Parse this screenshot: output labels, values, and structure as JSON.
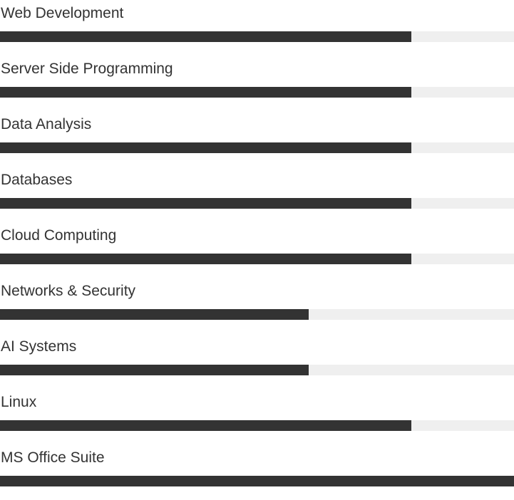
{
  "skills": [
    {
      "label": "Web Development",
      "level": 0.8
    },
    {
      "label": "Server Side Programming",
      "level": 0.8
    },
    {
      "label": "Data Analysis",
      "level": 0.8
    },
    {
      "label": "Databases",
      "level": 0.8
    },
    {
      "label": "Cloud Computing",
      "level": 0.8
    },
    {
      "label": "Networks & Security",
      "level": 0.6
    },
    {
      "label": "AI Systems",
      "level": 0.6
    },
    {
      "label": "Linux",
      "level": 0.8
    },
    {
      "label": "MS Office Suite",
      "level": 1.0
    }
  ],
  "colors": {
    "fill": "#333333",
    "track": "#efefef",
    "text": "#333333"
  }
}
